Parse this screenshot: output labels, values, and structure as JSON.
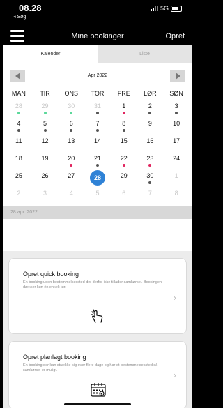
{
  "status": {
    "time": "08.28",
    "back_label": "◂ Søg",
    "network": "5G"
  },
  "header": {
    "title": "Mine bookinger",
    "action": "Opret"
  },
  "tabs": [
    {
      "label": "Kalender",
      "active": true
    },
    {
      "label": "Liste",
      "active": false
    }
  ],
  "calendar": {
    "month_label": "Apr 2022",
    "weekdays": [
      "MAN",
      "TIR",
      "ONS",
      "TOR",
      "FRE",
      "LØR",
      "SØN"
    ],
    "days": [
      {
        "d": "28",
        "muted": true,
        "dot": "green"
      },
      {
        "d": "29",
        "muted": true,
        "dot": "green"
      },
      {
        "d": "30",
        "muted": true,
        "dot": "green"
      },
      {
        "d": "31",
        "muted": true,
        "dot": "gray"
      },
      {
        "d": "1",
        "dot": "red"
      },
      {
        "d": "2",
        "dot": "gray"
      },
      {
        "d": "3",
        "dot": "gray"
      },
      {
        "d": "4",
        "dot": "gray"
      },
      {
        "d": "5",
        "dot": "gray"
      },
      {
        "d": "6",
        "dot": "gray"
      },
      {
        "d": "7",
        "dot": "gray"
      },
      {
        "d": "8",
        "dot": "gray"
      },
      {
        "d": "9"
      },
      {
        "d": "10"
      },
      {
        "d": "11"
      },
      {
        "d": "12"
      },
      {
        "d": "13"
      },
      {
        "d": "14"
      },
      {
        "d": "15"
      },
      {
        "d": "16"
      },
      {
        "d": "17"
      },
      {
        "d": "18"
      },
      {
        "d": "19"
      },
      {
        "d": "20",
        "dot": "red"
      },
      {
        "d": "21",
        "dot": "gray"
      },
      {
        "d": "22",
        "dot": "red"
      },
      {
        "d": "23",
        "dot": "red"
      },
      {
        "d": "24"
      },
      {
        "d": "25"
      },
      {
        "d": "26"
      },
      {
        "d": "27"
      },
      {
        "d": "28",
        "selected": true
      },
      {
        "d": "29"
      },
      {
        "d": "30",
        "dot": "gray"
      },
      {
        "d": "1",
        "muted": true
      },
      {
        "d": "2",
        "muted": true
      },
      {
        "d": "3",
        "muted": true
      },
      {
        "d": "4",
        "muted": true
      },
      {
        "d": "5",
        "muted": true
      },
      {
        "d": "6",
        "muted": true
      },
      {
        "d": "7",
        "muted": true
      },
      {
        "d": "8",
        "muted": true
      }
    ]
  },
  "selected_date": "28.apr. 2022",
  "cards": [
    {
      "title": "Opret quick booking",
      "desc": "En booking uden bestemmelsessted der derfor ikke tillader samkørsel. Bookingen dækker kun én enkelt tur.",
      "icon": "hand-tap-icon"
    },
    {
      "title": "Opret planlagt booking",
      "desc": "En booking der kan strække sig over flere dage og har et bestemmelsessted så samkørsel er muligt.",
      "icon": "calendar-icon"
    }
  ],
  "colors": {
    "selected": "#2f82d6",
    "dot_green": "#5bd89a",
    "dot_red": "#e0245e",
    "dot_gray": "#555555"
  }
}
